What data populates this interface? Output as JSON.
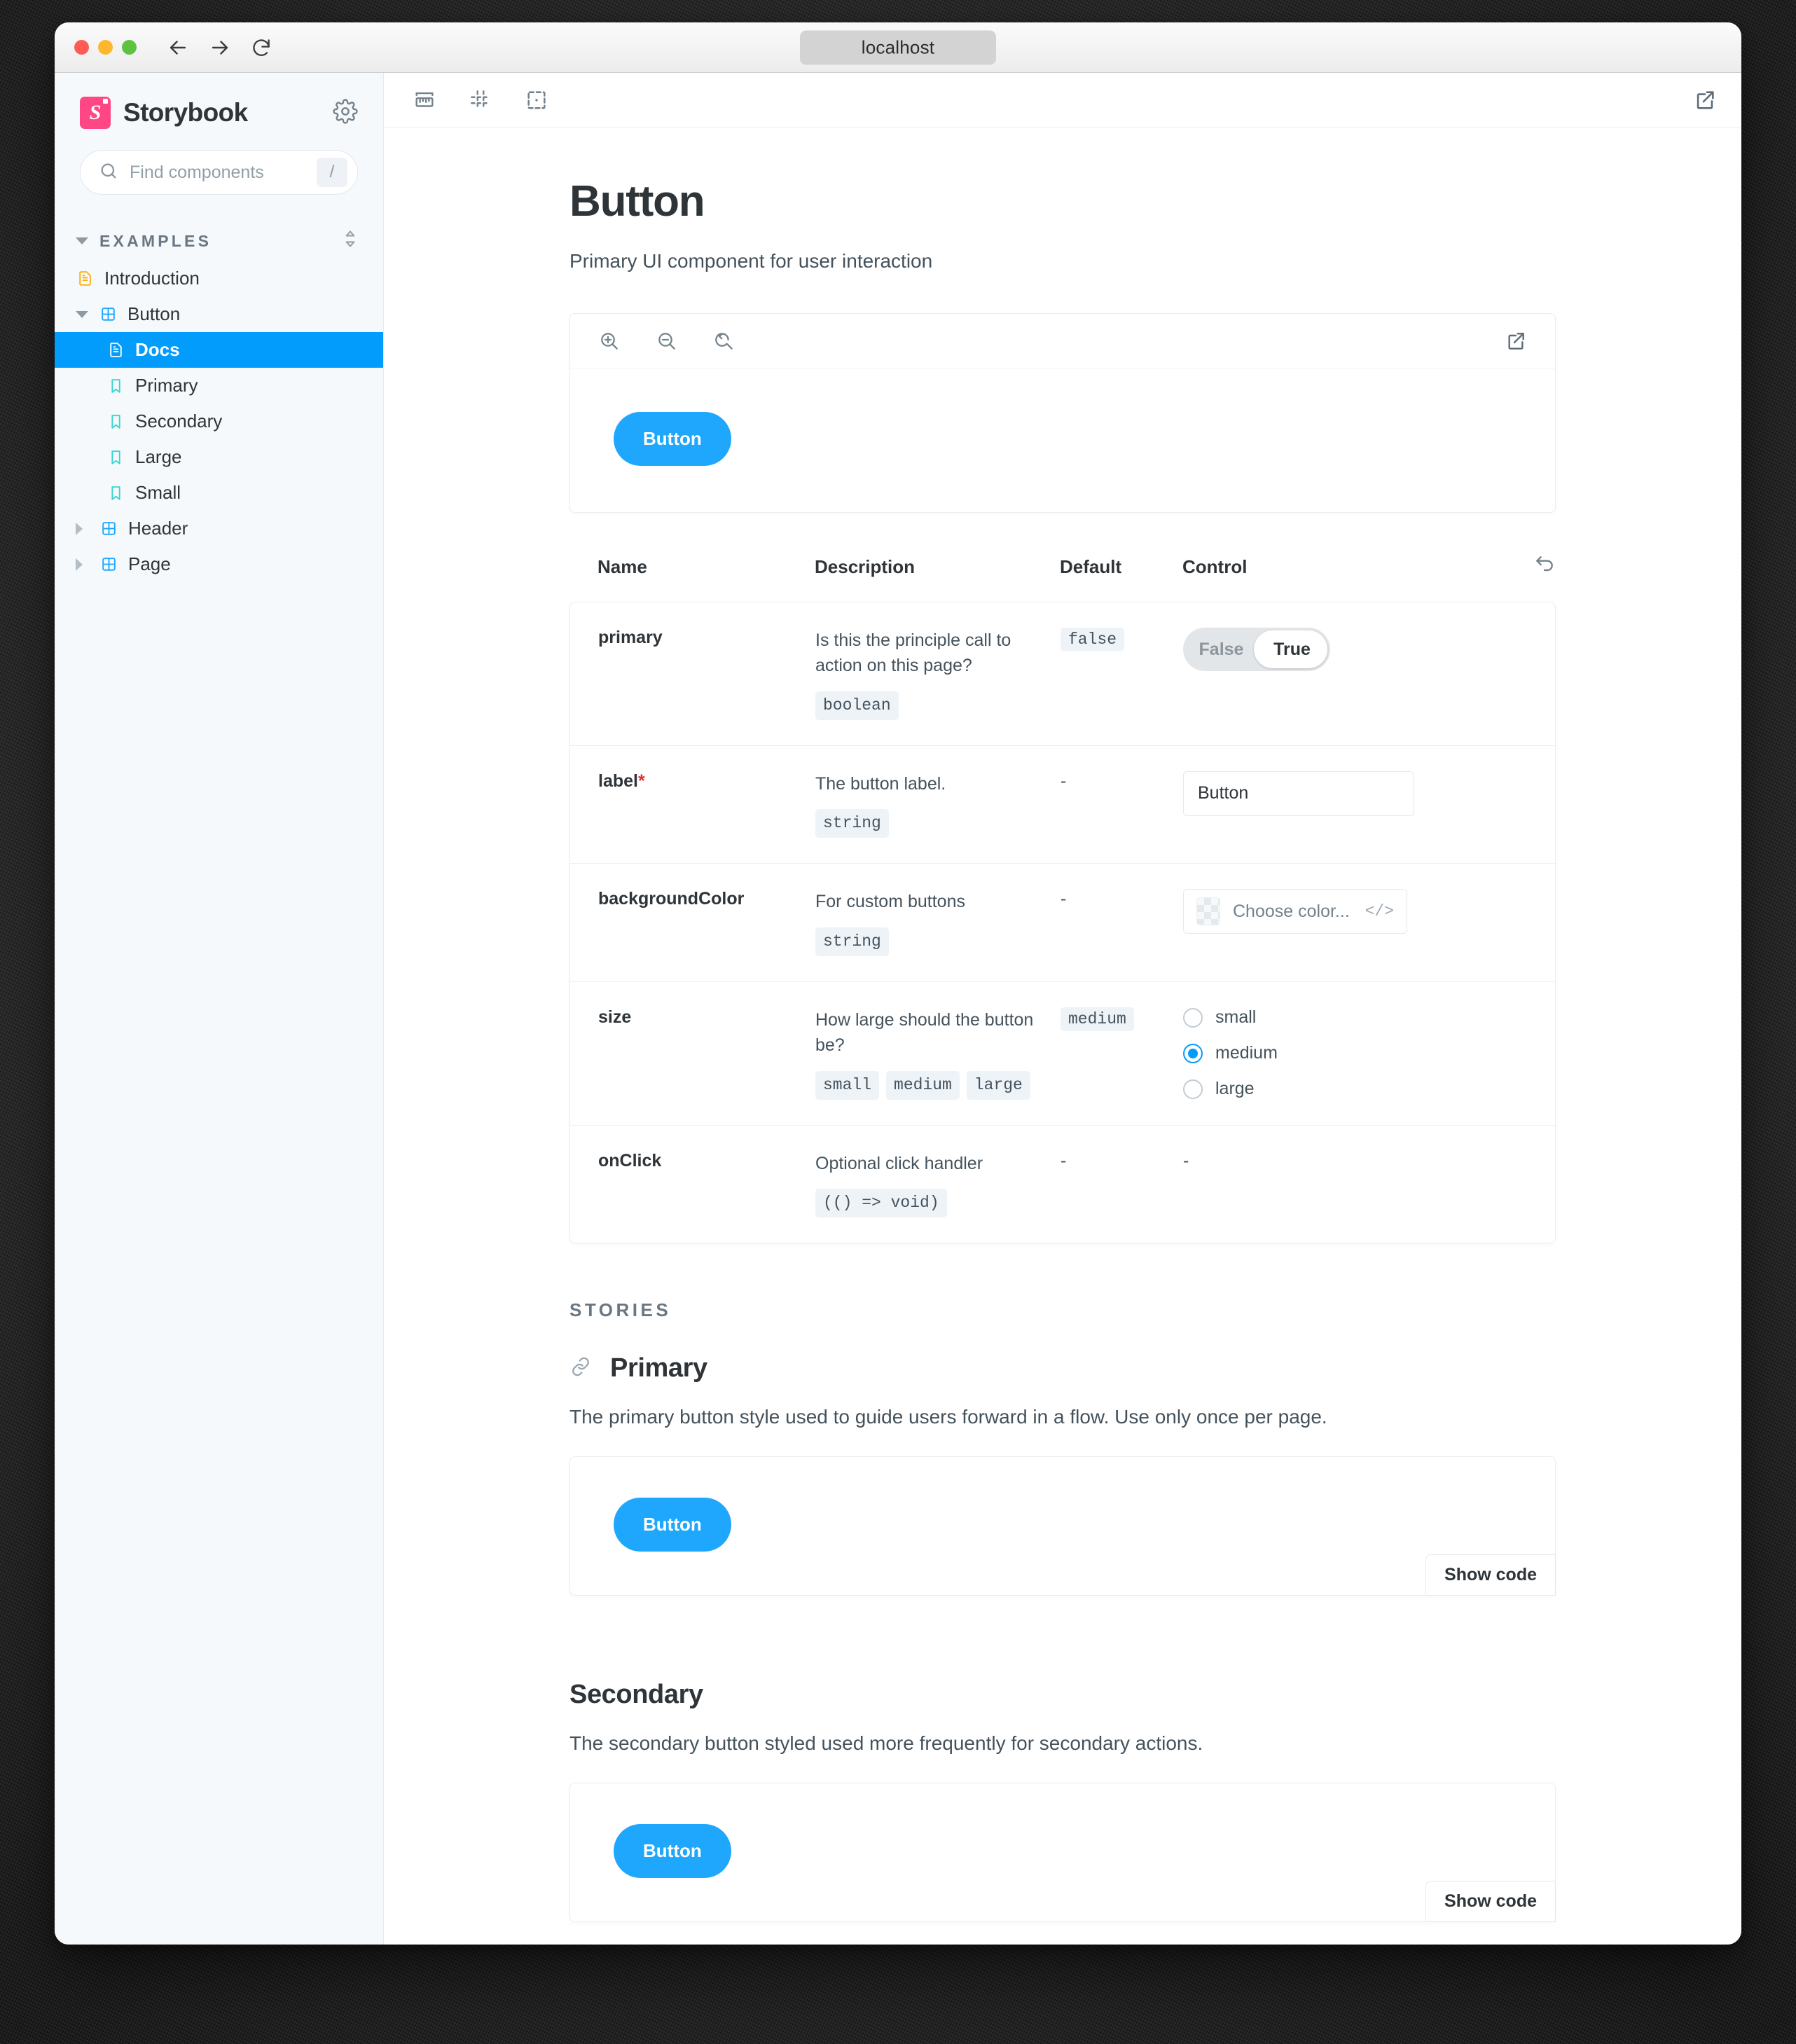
{
  "browser": {
    "url": "localhost",
    "back_icon": "arrow-left-icon",
    "forward_icon": "arrow-right-icon",
    "reload_icon": "reload-icon"
  },
  "sidebar": {
    "brand": "Storybook",
    "brand_mark": "S",
    "brand_color": "#ff4785",
    "settings_icon": "gear-icon",
    "search": {
      "placeholder": "Find components",
      "shortcut": "/"
    },
    "group": {
      "label": "EXAMPLES",
      "sort_icon": "sort-icon",
      "expanded": true
    },
    "items": [
      {
        "label": "Introduction",
        "icon": "document-icon",
        "level": 1,
        "selected": false,
        "expandable": false
      },
      {
        "label": "Button",
        "icon": "component-icon",
        "level": 1,
        "selected": false,
        "expandable": true,
        "expanded": true
      },
      {
        "label": "Docs",
        "icon": "document-icon",
        "level": 2,
        "selected": true,
        "expandable": false
      },
      {
        "label": "Primary",
        "icon": "bookmark-icon",
        "level": 2,
        "selected": false,
        "expandable": false
      },
      {
        "label": "Secondary",
        "icon": "bookmark-icon",
        "level": 2,
        "selected": false,
        "expandable": false
      },
      {
        "label": "Large",
        "icon": "bookmark-icon",
        "level": 2,
        "selected": false,
        "expandable": false
      },
      {
        "label": "Small",
        "icon": "bookmark-icon",
        "level": 2,
        "selected": false,
        "expandable": false
      },
      {
        "label": "Header",
        "icon": "component-icon",
        "level": 1,
        "selected": false,
        "expandable": true,
        "expanded": false
      },
      {
        "label": "Page",
        "icon": "component-icon",
        "level": 1,
        "selected": false,
        "expandable": true,
        "expanded": false
      }
    ],
    "selected_bg": "#029cfd"
  },
  "toolbar": {
    "measure_icon": "ruler-icon",
    "grid_icon": "grid-icon",
    "outline_icon": "outline-icon",
    "open_new_icon": "open-in-new-icon"
  },
  "page": {
    "title": "Button",
    "subtitle": "Primary UI component for user interaction"
  },
  "canvas": {
    "zoom_in_icon": "zoom-in-icon",
    "zoom_out_icon": "zoom-out-icon",
    "zoom_reset_icon": "zoom-reset-icon",
    "open_new_icon": "open-in-new-icon",
    "button_label": "Button",
    "button_color": "#1ea7fd"
  },
  "args_table": {
    "headers": [
      "Name",
      "Description",
      "Default",
      "Control"
    ],
    "reset_icon": "undo-icon",
    "rows": [
      {
        "name": "primary",
        "required": false,
        "description": "Is this the principle call to action on this page?",
        "types": [
          "boolean"
        ],
        "default": "false",
        "default_is_chip": true,
        "control": {
          "kind": "boolean-toggle",
          "options": [
            "False",
            "True"
          ],
          "value": "True"
        }
      },
      {
        "name": "label",
        "required": true,
        "required_mark": "*",
        "description": "The button label.",
        "types": [
          "string"
        ],
        "default": "-",
        "default_is_chip": false,
        "control": {
          "kind": "text",
          "value": "Button"
        }
      },
      {
        "name": "backgroundColor",
        "required": false,
        "description": "For custom buttons",
        "types": [
          "string"
        ],
        "default": "-",
        "default_is_chip": false,
        "control": {
          "kind": "color",
          "placeholder": "Choose color...",
          "code_icon": "</>"
        }
      },
      {
        "name": "size",
        "required": false,
        "description": "How large should the button be?",
        "types": [
          "small",
          "medium",
          "large"
        ],
        "default": "medium",
        "default_is_chip": true,
        "control": {
          "kind": "radio",
          "options": [
            "small",
            "medium",
            "large"
          ],
          "value": "medium"
        }
      },
      {
        "name": "onClick",
        "required": false,
        "description": "Optional click handler",
        "types": [
          "(() => void)"
        ],
        "default": "-",
        "default_is_chip": false,
        "control": {
          "kind": "none",
          "value": "-"
        }
      }
    ]
  },
  "stories": {
    "section_label": "STORIES",
    "items": [
      {
        "title": "Primary",
        "anchor_icon": "link-icon",
        "show_anchor": true,
        "description": "The primary button style used to guide users forward in a flow. Use only once per page.",
        "button_label": "Button",
        "show_code_label": "Show code"
      },
      {
        "title": "Secondary",
        "anchor_icon": "link-icon",
        "show_anchor": false,
        "description": "The secondary button styled used more frequently for secondary actions.",
        "button_label": "Button",
        "show_code_label": "Show code"
      }
    ]
  }
}
